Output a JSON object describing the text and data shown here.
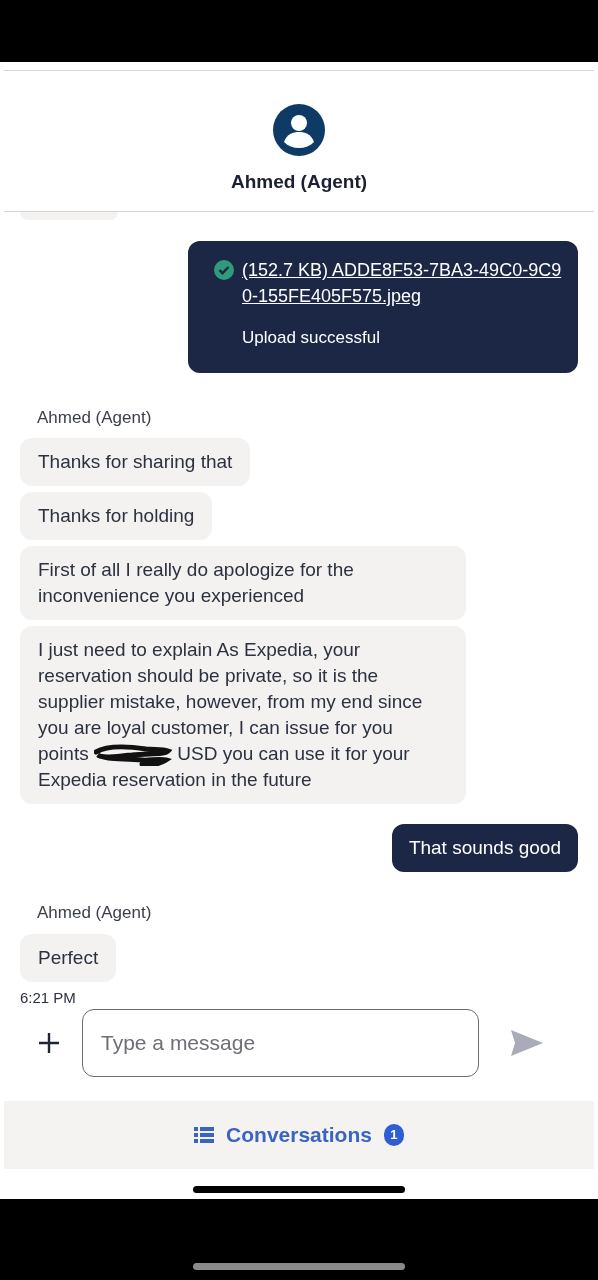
{
  "header": {
    "agent_name": "Ahmed (Agent)"
  },
  "messages": [
    {
      "kind": "upload",
      "file": "(152.7 KB) ADDE8F53-7BA3-49C0-9C90-155FE405F575.jpeg",
      "status": "Upload successful"
    },
    {
      "kind": "sender",
      "text": "Ahmed (Agent)"
    },
    {
      "kind": "agent",
      "text": "Thanks for sharing that"
    },
    {
      "kind": "agent",
      "text": "Thanks for holding"
    },
    {
      "kind": "agent",
      "text": "First of all I really do apologize for the inconvenience you experienced"
    },
    {
      "kind": "redacted",
      "before": "I just need to explain As Expedia, your reservation should be private, so it is the supplier mistake, however, from my end since you are loyal customer, I can issue for you points",
      "after": "USD you can use it for your Expedia reservation in the future"
    },
    {
      "kind": "user",
      "text": "That sounds good"
    },
    {
      "kind": "sender",
      "text": "Ahmed (Agent)"
    },
    {
      "kind": "agent",
      "text": "Perfect"
    },
    {
      "kind": "time",
      "text": "6:21 PM"
    }
  ],
  "composer": {
    "placeholder": "Type a message"
  },
  "bottom_bar": {
    "label": "Conversations",
    "badge": "1"
  }
}
